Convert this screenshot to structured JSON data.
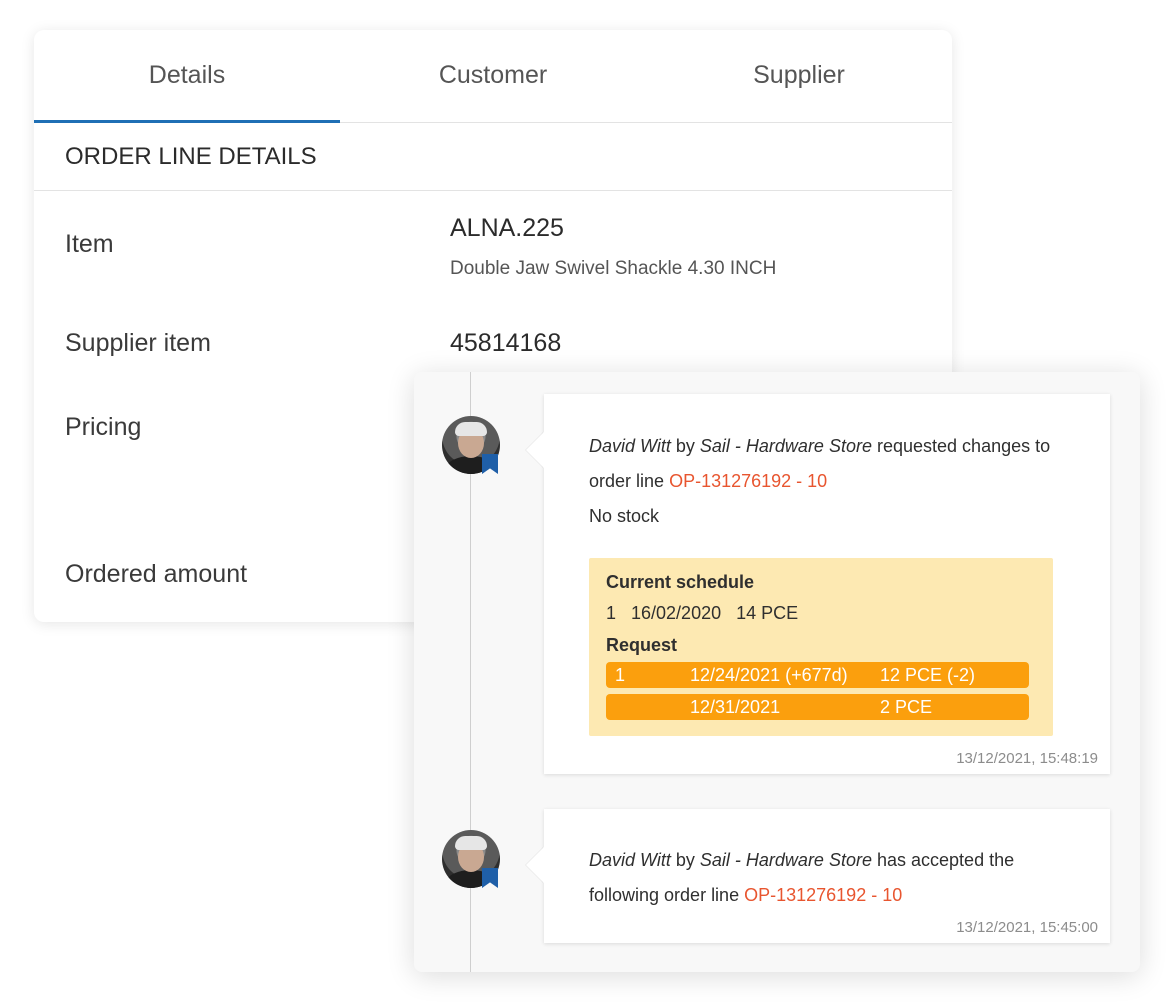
{
  "tabs": [
    {
      "label": "Details",
      "active": true
    },
    {
      "label": "Customer",
      "active": false
    },
    {
      "label": "Supplier",
      "active": false
    }
  ],
  "section_title": "ORDER LINE DETAILS",
  "rows": {
    "item_label": "Item",
    "item_value": "ALNA.225",
    "item_description": "Double Jaw Swivel Shackle 4.30 INCH",
    "supplier_item_label": "Supplier item",
    "supplier_item_value": "45814168",
    "pricing_label": "Pricing",
    "ordered_amount_label": "Ordered amount"
  },
  "activity": [
    {
      "user": "David Witt",
      "by": "by",
      "company": "Sail - Hardware Store",
      "action": "requested changes to order line",
      "order_ref": "OP-131276192 - 10",
      "note": "No stock",
      "current_schedule_title": "Current schedule",
      "current_schedule_line": "1   16/02/2020   14 PCE",
      "request_title": "Request",
      "requests": [
        {
          "line": "1",
          "date": "12/24/2021 (+677d)",
          "qty": "12 PCE (-2)"
        },
        {
          "line": "",
          "date": "12/31/2021",
          "qty": "2 PCE"
        }
      ],
      "timestamp": "13/12/2021, 15:48:19"
    },
    {
      "user": "David Witt",
      "by": "by",
      "company": "Sail - Hardware Store",
      "action": "has accepted the following order line",
      "order_ref": "OP-131276192 - 10",
      "timestamp": "13/12/2021, 15:45:00"
    }
  ],
  "colors": {
    "tab_indicator": "#1f6fb5",
    "link": "#e8552f",
    "schedule_bg": "#fde9b2",
    "request_bar": "#fb9f0d",
    "bookmark": "#1f5fa8"
  }
}
